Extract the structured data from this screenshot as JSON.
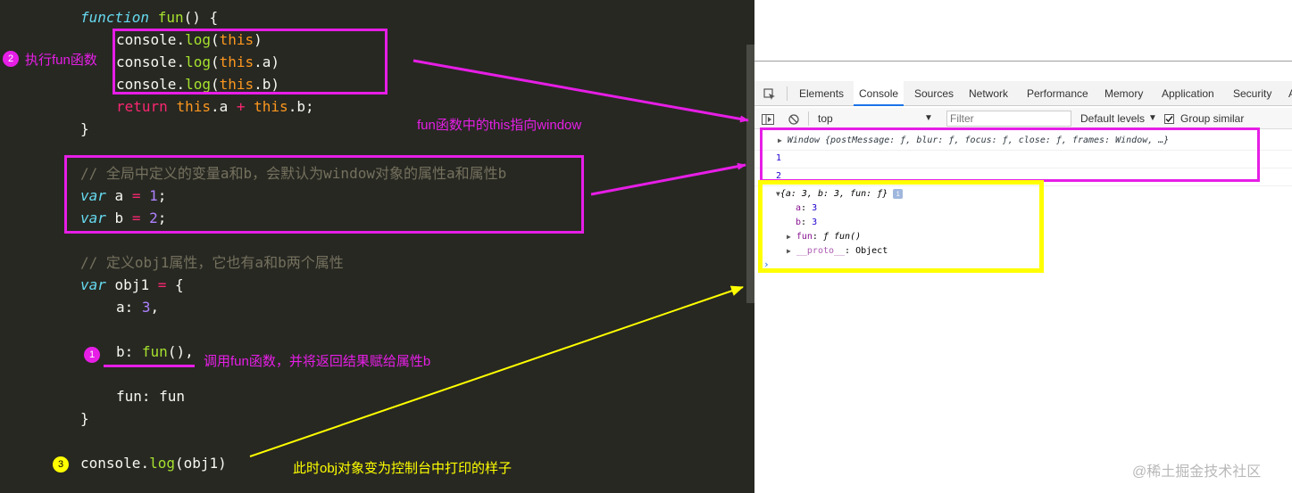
{
  "editor": {
    "line1_kw": "function",
    "line1_name": "fun",
    "line1_rest": "() {",
    "log_obj": "console",
    "log_fn": "log",
    "log_this": "this",
    "log1_close": ")",
    "log2_prop": ".a)",
    "log3_prop": ".b)",
    "return_kw": "return",
    "return_this1": "this",
    "return_a": ".a ",
    "return_plus": "+",
    "return_this2": "this",
    "return_b": ".b;",
    "close_brace": "}",
    "comment_global": "// 全局中定义的变量a和b，会默认为window对象的属性a和属性b",
    "var_kw": "var",
    "var_a": " a ",
    "var_b": " b ",
    "eq": "=",
    "val_1": "1",
    "val_2": "2",
    "semi": ";",
    "comment_obj": "// 定义obj1属性，它也有a和b两个属性",
    "obj_decl": " obj1 ",
    "obj_open": "{",
    "prop_a": "a: ",
    "prop_a_val": "3",
    "prop_a_comma": ",",
    "prop_b": "b: ",
    "prop_b_call": "fun",
    "prop_b_rest": "(),",
    "prop_fun": "fun: fun",
    "obj_close": "}",
    "final_obj": "console",
    "final_fn": "log",
    "final_rest": "(obj1)"
  },
  "annotations": {
    "step1_num": "1",
    "step1_text": "调用fun函数，并将返回结果赋给属性b",
    "step2_num": "2",
    "step2_text": "执行fun函数",
    "step3_num": "3",
    "step3_text": "此时obj对象变为控制台中打印的样子",
    "this_window_text": "fun函数中的this指向window",
    "colors": {
      "magenta": "#e61ee6",
      "yellow": "#ffff00"
    }
  },
  "devtools": {
    "tabs": [
      "Elements",
      "Console",
      "Sources",
      "Network",
      "Performance",
      "Memory",
      "Application",
      "Security",
      "A"
    ],
    "active_tab": "Console",
    "context": "top",
    "filter_placeholder": "Filter",
    "levels": "Default levels",
    "group_similar": "Group similar",
    "window_line": "Window {postMessage: ƒ, blur: ƒ, focus: ƒ, close: ƒ, frames: Window, …}",
    "out1": "1",
    "out2": "2",
    "obj_summary": "{a: 3, b: 3, fun: ƒ}",
    "obj_a_key": "a",
    "obj_a_val": "3",
    "obj_b_key": "b",
    "obj_b_val": "3",
    "obj_fun_key": "fun",
    "obj_fun_val": "ƒ fun()",
    "obj_proto_key": "__proto__",
    "obj_proto_val": "Object",
    "info_badge": "i"
  },
  "watermark": "@稀土掘金技术社区"
}
